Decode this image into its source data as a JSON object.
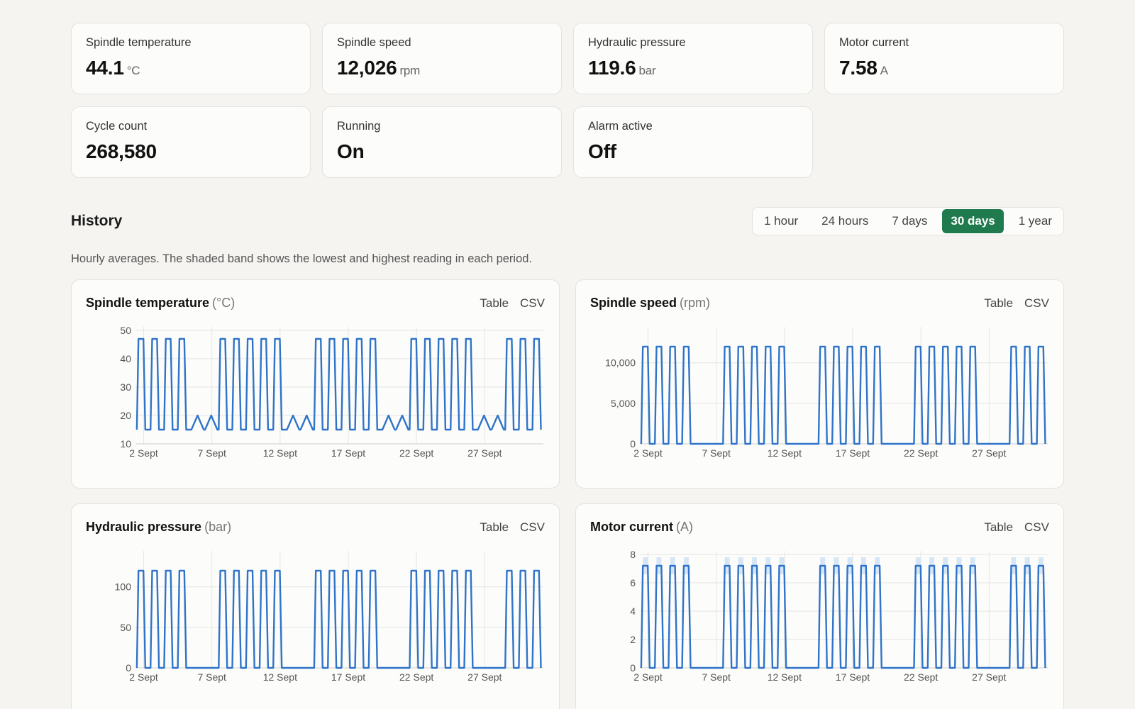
{
  "tiles": [
    {
      "label": "Spindle temperature",
      "value": "44.1",
      "unit": "°C"
    },
    {
      "label": "Spindle speed",
      "value": "12,026",
      "unit": "rpm"
    },
    {
      "label": "Hydraulic pressure",
      "value": "119.6",
      "unit": "bar"
    },
    {
      "label": "Motor current",
      "value": "7.58",
      "unit": "A"
    },
    {
      "label": "Cycle count",
      "value": "268,580",
      "unit": ""
    },
    {
      "label": "Running",
      "value": "On",
      "unit": ""
    },
    {
      "label": "Alarm active",
      "value": "Off",
      "unit": ""
    }
  ],
  "history": {
    "title": "History",
    "description": "Hourly averages. The shaded band shows the lowest and highest reading in each period.",
    "ranges": [
      "1 hour",
      "24 hours",
      "7 days",
      "30 days",
      "1 year"
    ],
    "selected_range": "30 days",
    "accent_color": "#1f7a4d"
  },
  "chart_actions": {
    "table": "Table",
    "csv": "CSV"
  },
  "chart_data": [
    {
      "type": "line",
      "title": "Spindle temperature",
      "unit_label": "(°C)",
      "x_tick_labels": [
        "2 Sept",
        "7 Sept",
        "12 Sept",
        "17 Sept",
        "22 Sept",
        "27 Sept"
      ],
      "x_tick_days": [
        2,
        7,
        12,
        17,
        22,
        27
      ],
      "xlim": [
        1.4,
        31.3
      ],
      "ylim": [
        10,
        50
      ],
      "y_ticks": [
        10,
        20,
        30,
        40,
        50
      ],
      "y_tick_labels": [
        "10",
        "20",
        "30",
        "40",
        "50"
      ],
      "line_color": "#2f74c8",
      "series": [
        {
          "pattern": "daily_cycle",
          "running_value": 47,
          "idle_value": 15,
          "idle_day_value": 20,
          "idle_weekdays": [
            6,
            7,
            13,
            14,
            20,
            21,
            27,
            28
          ],
          "band": false
        }
      ]
    },
    {
      "type": "line",
      "title": "Spindle speed",
      "unit_label": "(rpm)",
      "x_tick_labels": [
        "2 Sept",
        "7 Sept",
        "12 Sept",
        "17 Sept",
        "22 Sept",
        "27 Sept"
      ],
      "x_tick_days": [
        2,
        7,
        12,
        17,
        22,
        27
      ],
      "xlim": [
        1.4,
        31.3
      ],
      "ylim": [
        0,
        14000
      ],
      "y_ticks": [
        0,
        5000,
        10000
      ],
      "y_tick_labels": [
        "0",
        "5,000",
        "10,000"
      ],
      "line_color": "#2f74c8",
      "series": [
        {
          "pattern": "daily_cycle",
          "running_value": 12000,
          "idle_value": 0,
          "idle_day_value": 0,
          "idle_weekdays": [
            6,
            7,
            13,
            14,
            20,
            21,
            27,
            28
          ],
          "band": false
        }
      ]
    },
    {
      "type": "line",
      "title": "Hydraulic pressure",
      "unit_label": "(bar)",
      "x_tick_labels": [
        "2 Sept",
        "7 Sept",
        "12 Sept",
        "17 Sept",
        "22 Sept",
        "27 Sept"
      ],
      "x_tick_days": [
        2,
        7,
        12,
        17,
        22,
        27
      ],
      "xlim": [
        1.4,
        31.3
      ],
      "ylim": [
        0,
        140
      ],
      "y_ticks": [
        0,
        50,
        100
      ],
      "y_tick_labels": [
        "0",
        "50",
        "100"
      ],
      "line_color": "#2f74c8",
      "series": [
        {
          "pattern": "daily_cycle",
          "running_value": 120,
          "idle_value": 0,
          "idle_day_value": 0,
          "idle_weekdays": [
            6,
            7,
            13,
            14,
            20,
            21,
            27,
            28
          ],
          "band": false
        }
      ]
    },
    {
      "type": "line",
      "title": "Motor current",
      "unit_label": "(A)",
      "x_tick_labels": [
        "2 Sept",
        "7 Sept",
        "12 Sept",
        "17 Sept",
        "22 Sept",
        "27 Sept"
      ],
      "x_tick_days": [
        2,
        7,
        12,
        17,
        22,
        27
      ],
      "xlim": [
        1.4,
        31.3
      ],
      "ylim": [
        0,
        8
      ],
      "y_ticks": [
        0,
        2,
        4,
        6,
        8
      ],
      "y_tick_labels": [
        "0",
        "2",
        "4",
        "6",
        "8"
      ],
      "line_color": "#2f74c8",
      "band_color": "#d6e6f7",
      "series": [
        {
          "pattern": "daily_cycle",
          "running_value": 7.2,
          "idle_value": 0,
          "idle_day_value": 0,
          "band_low": 6.6,
          "band_high": 7.8,
          "idle_weekdays": [
            6,
            7,
            13,
            14,
            20,
            21,
            27,
            28
          ],
          "band": true
        }
      ]
    }
  ]
}
